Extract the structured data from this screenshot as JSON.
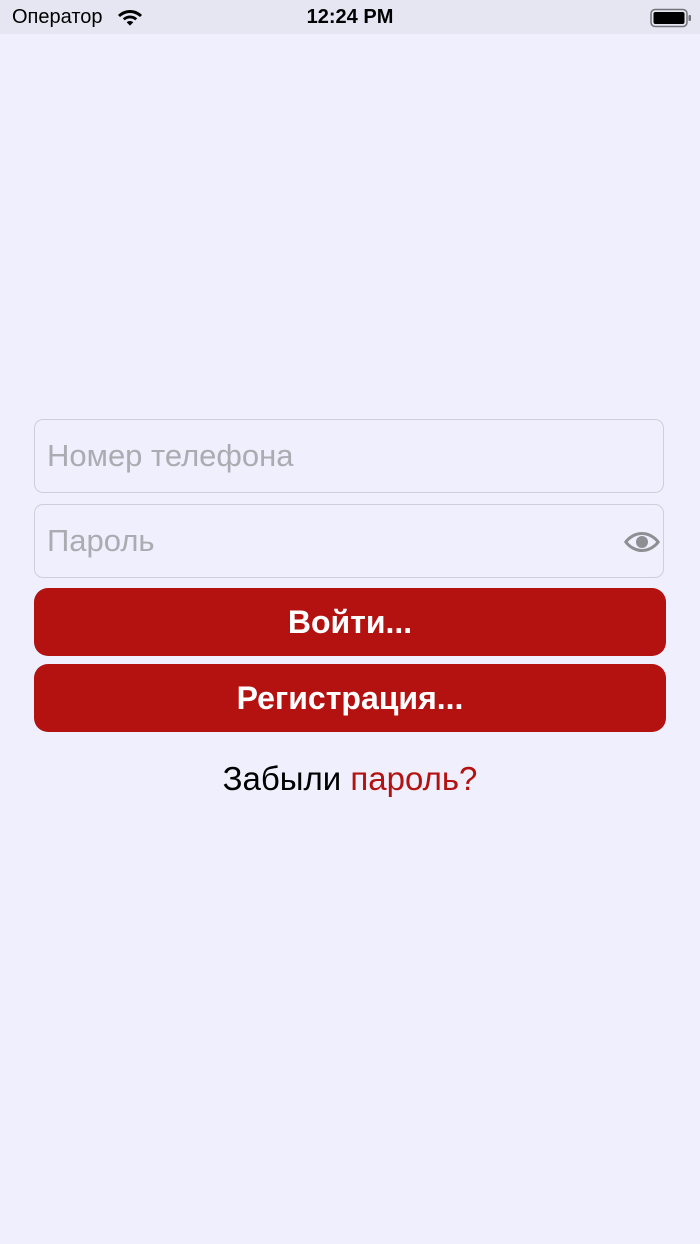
{
  "status_bar": {
    "carrier": "Оператор",
    "time": "12:24 PM",
    "wifi_icon": "wifi-icon",
    "battery_icon": "battery-icon"
  },
  "form": {
    "phone_placeholder": "Номер телефона",
    "phone_value": "",
    "password_placeholder": "Пароль",
    "password_value": "",
    "password_toggle_icon": "eye-icon"
  },
  "buttons": {
    "login_label": "Войти...",
    "register_label": "Регистрация..."
  },
  "forgot": {
    "prefix": "Забыли",
    "link_label": "пароль?"
  },
  "colors": {
    "background": "#EFEFFD",
    "accent": "#B41111",
    "placeholder": "#ABABB1",
    "eye_icon": "#8E8E93"
  }
}
